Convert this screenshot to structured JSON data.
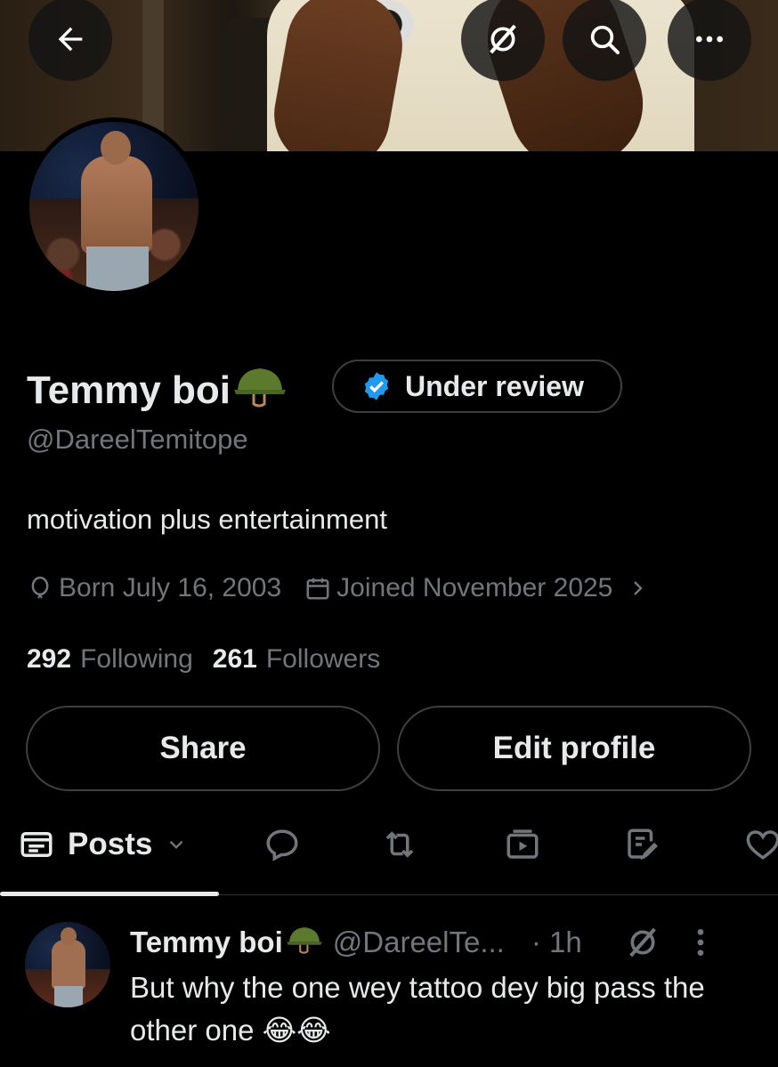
{
  "profile": {
    "display_name": "Temmy boi",
    "name_emoji": "military-helmet",
    "verification_label": "Under review",
    "handle": "@DareelTemitope",
    "bio": "motivation plus entertainment",
    "born": "Born July 16, 2003",
    "joined": "Joined November 2025",
    "following_count": "292",
    "following_label": "Following",
    "followers_count": "261",
    "followers_label": "Followers"
  },
  "actions": {
    "share_label": "Share",
    "edit_label": "Edit profile"
  },
  "tabs": {
    "posts_label": "Posts",
    "items": [
      "posts",
      "replies",
      "reposts",
      "videos",
      "articles",
      "likes"
    ]
  },
  "post": {
    "author": "Temmy boi",
    "handle": "@DareelTe...",
    "time": "· 1h",
    "text": "But why the one wey tattoo dey big pass the other one 😂😂"
  },
  "colors": {
    "background": "#000000",
    "text": "#e7e9ea",
    "muted": "#71767b",
    "verified_blue": "#1d9bf0",
    "border": "#3c4043"
  }
}
